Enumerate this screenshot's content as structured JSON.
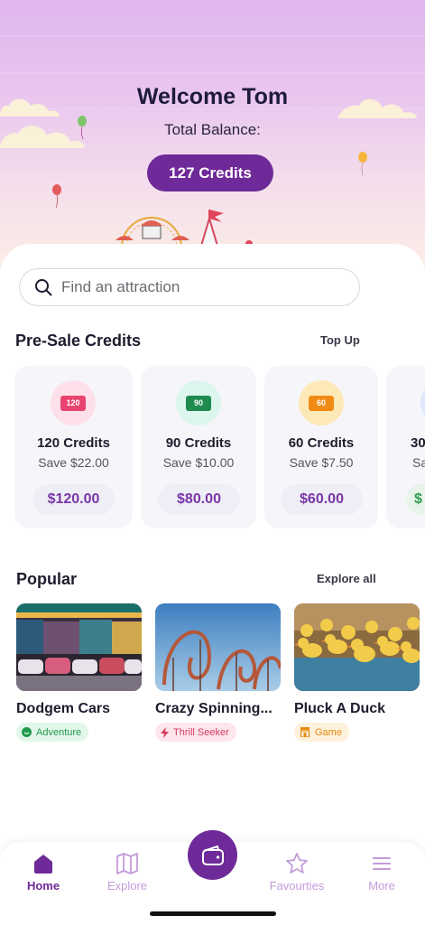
{
  "header": {
    "welcome": "Welcome Tom",
    "balance_label": "Total Balance:",
    "balance_value": "127 Credits"
  },
  "search": {
    "placeholder": "Find an attraction"
  },
  "presale": {
    "title": "Pre-Sale Credits",
    "action": "Top Up",
    "cards": [
      {
        "ticket": "120",
        "name": "120 Credits",
        "save": "Save $22.00",
        "price": "$120.00",
        "color": "#e8446f",
        "badge_bg": "#fde0ea"
      },
      {
        "ticket": "90",
        "name": "90 Credits",
        "save": "Save $10.00",
        "price": "$80.00",
        "color": "#1e8a4e",
        "badge_bg": "#dcf6ee"
      },
      {
        "ticket": "60",
        "name": "60 Credits",
        "save": "Save $7.50",
        "price": "$60.00",
        "color": "#f08b16",
        "badge_bg": "#fde9b8"
      },
      {
        "ticket": "30",
        "name": "30",
        "save": "Sa",
        "price": "$",
        "color": "#3a7bd5",
        "badge_bg": "#dde8fb"
      }
    ]
  },
  "popular": {
    "title": "Popular",
    "action": "Explore all",
    "items": [
      {
        "title": "Dodgem Cars",
        "tag": "Adventure",
        "tag_color": "#1f9a4b",
        "tag_bg": "#e3f6ea",
        "icon": "smile-icon"
      },
      {
        "title": "Crazy Spinning...",
        "tag": "Thrill Seeker",
        "tag_color": "#d63a5e",
        "tag_bg": "#fde6ec",
        "icon": "lightning-icon"
      },
      {
        "title": "Pluck A Duck",
        "tag": "Game",
        "tag_color": "#e68a0f",
        "tag_bg": "#fdf1dc",
        "icon": "booth-icon"
      }
    ]
  },
  "nav": {
    "items": [
      {
        "label": "Home",
        "icon": "home-icon",
        "active": true
      },
      {
        "label": "Explore",
        "icon": "map-icon",
        "active": false
      },
      {
        "label": "Favourties",
        "icon": "star-icon",
        "active": false
      },
      {
        "label": "More",
        "icon": "menu-icon",
        "active": false
      }
    ],
    "center_icon": "wallet-icon"
  },
  "colors": {
    "brand": "#6e2a98",
    "brand_light": "#c39bd9"
  }
}
